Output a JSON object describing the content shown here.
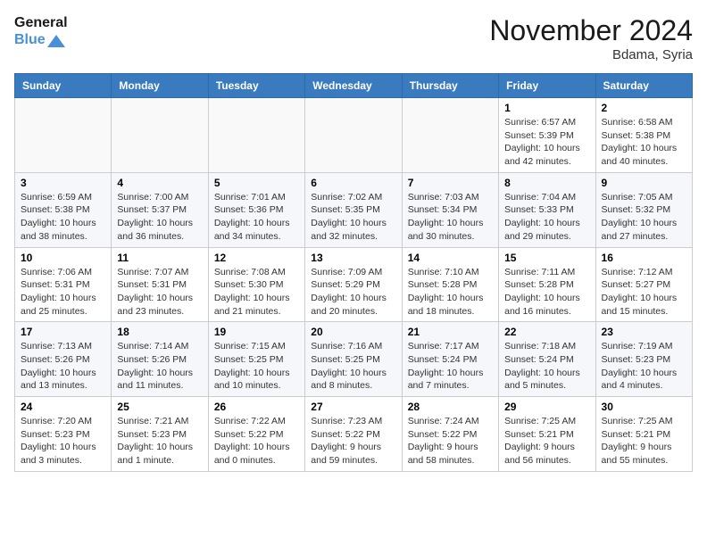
{
  "logo": {
    "line1": "General",
    "line2": "Blue"
  },
  "title": "November 2024",
  "location": "Bdama, Syria",
  "days_of_week": [
    "Sunday",
    "Monday",
    "Tuesday",
    "Wednesday",
    "Thursday",
    "Friday",
    "Saturday"
  ],
  "weeks": [
    [
      {
        "day": "",
        "info": ""
      },
      {
        "day": "",
        "info": ""
      },
      {
        "day": "",
        "info": ""
      },
      {
        "day": "",
        "info": ""
      },
      {
        "day": "",
        "info": ""
      },
      {
        "day": "1",
        "info": "Sunrise: 6:57 AM\nSunset: 5:39 PM\nDaylight: 10 hours\nand 42 minutes."
      },
      {
        "day": "2",
        "info": "Sunrise: 6:58 AM\nSunset: 5:38 PM\nDaylight: 10 hours\nand 40 minutes."
      }
    ],
    [
      {
        "day": "3",
        "info": "Sunrise: 6:59 AM\nSunset: 5:38 PM\nDaylight: 10 hours\nand 38 minutes."
      },
      {
        "day": "4",
        "info": "Sunrise: 7:00 AM\nSunset: 5:37 PM\nDaylight: 10 hours\nand 36 minutes."
      },
      {
        "day": "5",
        "info": "Sunrise: 7:01 AM\nSunset: 5:36 PM\nDaylight: 10 hours\nand 34 minutes."
      },
      {
        "day": "6",
        "info": "Sunrise: 7:02 AM\nSunset: 5:35 PM\nDaylight: 10 hours\nand 32 minutes."
      },
      {
        "day": "7",
        "info": "Sunrise: 7:03 AM\nSunset: 5:34 PM\nDaylight: 10 hours\nand 30 minutes."
      },
      {
        "day": "8",
        "info": "Sunrise: 7:04 AM\nSunset: 5:33 PM\nDaylight: 10 hours\nand 29 minutes."
      },
      {
        "day": "9",
        "info": "Sunrise: 7:05 AM\nSunset: 5:32 PM\nDaylight: 10 hours\nand 27 minutes."
      }
    ],
    [
      {
        "day": "10",
        "info": "Sunrise: 7:06 AM\nSunset: 5:31 PM\nDaylight: 10 hours\nand 25 minutes."
      },
      {
        "day": "11",
        "info": "Sunrise: 7:07 AM\nSunset: 5:31 PM\nDaylight: 10 hours\nand 23 minutes."
      },
      {
        "day": "12",
        "info": "Sunrise: 7:08 AM\nSunset: 5:30 PM\nDaylight: 10 hours\nand 21 minutes."
      },
      {
        "day": "13",
        "info": "Sunrise: 7:09 AM\nSunset: 5:29 PM\nDaylight: 10 hours\nand 20 minutes."
      },
      {
        "day": "14",
        "info": "Sunrise: 7:10 AM\nSunset: 5:28 PM\nDaylight: 10 hours\nand 18 minutes."
      },
      {
        "day": "15",
        "info": "Sunrise: 7:11 AM\nSunset: 5:28 PM\nDaylight: 10 hours\nand 16 minutes."
      },
      {
        "day": "16",
        "info": "Sunrise: 7:12 AM\nSunset: 5:27 PM\nDaylight: 10 hours\nand 15 minutes."
      }
    ],
    [
      {
        "day": "17",
        "info": "Sunrise: 7:13 AM\nSunset: 5:26 PM\nDaylight: 10 hours\nand 13 minutes."
      },
      {
        "day": "18",
        "info": "Sunrise: 7:14 AM\nSunset: 5:26 PM\nDaylight: 10 hours\nand 11 minutes."
      },
      {
        "day": "19",
        "info": "Sunrise: 7:15 AM\nSunset: 5:25 PM\nDaylight: 10 hours\nand 10 minutes."
      },
      {
        "day": "20",
        "info": "Sunrise: 7:16 AM\nSunset: 5:25 PM\nDaylight: 10 hours\nand 8 minutes."
      },
      {
        "day": "21",
        "info": "Sunrise: 7:17 AM\nSunset: 5:24 PM\nDaylight: 10 hours\nand 7 minutes."
      },
      {
        "day": "22",
        "info": "Sunrise: 7:18 AM\nSunset: 5:24 PM\nDaylight: 10 hours\nand 5 minutes."
      },
      {
        "day": "23",
        "info": "Sunrise: 7:19 AM\nSunset: 5:23 PM\nDaylight: 10 hours\nand 4 minutes."
      }
    ],
    [
      {
        "day": "24",
        "info": "Sunrise: 7:20 AM\nSunset: 5:23 PM\nDaylight: 10 hours\nand 3 minutes."
      },
      {
        "day": "25",
        "info": "Sunrise: 7:21 AM\nSunset: 5:23 PM\nDaylight: 10 hours\nand 1 minute."
      },
      {
        "day": "26",
        "info": "Sunrise: 7:22 AM\nSunset: 5:22 PM\nDaylight: 10 hours\nand 0 minutes."
      },
      {
        "day": "27",
        "info": "Sunrise: 7:23 AM\nSunset: 5:22 PM\nDaylight: 9 hours\nand 59 minutes."
      },
      {
        "day": "28",
        "info": "Sunrise: 7:24 AM\nSunset: 5:22 PM\nDaylight: 9 hours\nand 58 minutes."
      },
      {
        "day": "29",
        "info": "Sunrise: 7:25 AM\nSunset: 5:21 PM\nDaylight: 9 hours\nand 56 minutes."
      },
      {
        "day": "30",
        "info": "Sunrise: 7:25 AM\nSunset: 5:21 PM\nDaylight: 9 hours\nand 55 minutes."
      }
    ]
  ]
}
